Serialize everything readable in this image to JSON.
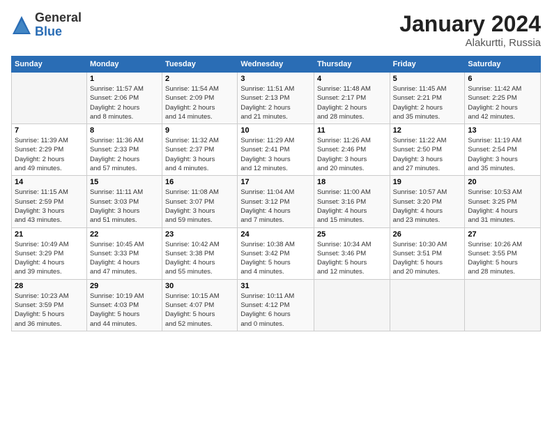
{
  "logo": {
    "general": "General",
    "blue": "Blue"
  },
  "title": "January 2024",
  "location": "Alakurtti, Russia",
  "days_header": [
    "Sunday",
    "Monday",
    "Tuesday",
    "Wednesday",
    "Thursday",
    "Friday",
    "Saturday"
  ],
  "weeks": [
    [
      {
        "num": "",
        "info": ""
      },
      {
        "num": "1",
        "info": "Sunrise: 11:57 AM\nSunset: 2:06 PM\nDaylight: 2 hours\nand 8 minutes."
      },
      {
        "num": "2",
        "info": "Sunrise: 11:54 AM\nSunset: 2:09 PM\nDaylight: 2 hours\nand 14 minutes."
      },
      {
        "num": "3",
        "info": "Sunrise: 11:51 AM\nSunset: 2:13 PM\nDaylight: 2 hours\nand 21 minutes."
      },
      {
        "num": "4",
        "info": "Sunrise: 11:48 AM\nSunset: 2:17 PM\nDaylight: 2 hours\nand 28 minutes."
      },
      {
        "num": "5",
        "info": "Sunrise: 11:45 AM\nSunset: 2:21 PM\nDaylight: 2 hours\nand 35 minutes."
      },
      {
        "num": "6",
        "info": "Sunrise: 11:42 AM\nSunset: 2:25 PM\nDaylight: 2 hours\nand 42 minutes."
      }
    ],
    [
      {
        "num": "7",
        "info": "Sunrise: 11:39 AM\nSunset: 2:29 PM\nDaylight: 2 hours\nand 49 minutes."
      },
      {
        "num": "8",
        "info": "Sunrise: 11:36 AM\nSunset: 2:33 PM\nDaylight: 2 hours\nand 57 minutes."
      },
      {
        "num": "9",
        "info": "Sunrise: 11:32 AM\nSunset: 2:37 PM\nDaylight: 3 hours\nand 4 minutes."
      },
      {
        "num": "10",
        "info": "Sunrise: 11:29 AM\nSunset: 2:41 PM\nDaylight: 3 hours\nand 12 minutes."
      },
      {
        "num": "11",
        "info": "Sunrise: 11:26 AM\nSunset: 2:46 PM\nDaylight: 3 hours\nand 20 minutes."
      },
      {
        "num": "12",
        "info": "Sunrise: 11:22 AM\nSunset: 2:50 PM\nDaylight: 3 hours\nand 27 minutes."
      },
      {
        "num": "13",
        "info": "Sunrise: 11:19 AM\nSunset: 2:54 PM\nDaylight: 3 hours\nand 35 minutes."
      }
    ],
    [
      {
        "num": "14",
        "info": "Sunrise: 11:15 AM\nSunset: 2:59 PM\nDaylight: 3 hours\nand 43 minutes."
      },
      {
        "num": "15",
        "info": "Sunrise: 11:11 AM\nSunset: 3:03 PM\nDaylight: 3 hours\nand 51 minutes."
      },
      {
        "num": "16",
        "info": "Sunrise: 11:08 AM\nSunset: 3:07 PM\nDaylight: 3 hours\nand 59 minutes."
      },
      {
        "num": "17",
        "info": "Sunrise: 11:04 AM\nSunset: 3:12 PM\nDaylight: 4 hours\nand 7 minutes."
      },
      {
        "num": "18",
        "info": "Sunrise: 11:00 AM\nSunset: 3:16 PM\nDaylight: 4 hours\nand 15 minutes."
      },
      {
        "num": "19",
        "info": "Sunrise: 10:57 AM\nSunset: 3:20 PM\nDaylight: 4 hours\nand 23 minutes."
      },
      {
        "num": "20",
        "info": "Sunrise: 10:53 AM\nSunset: 3:25 PM\nDaylight: 4 hours\nand 31 minutes."
      }
    ],
    [
      {
        "num": "21",
        "info": "Sunrise: 10:49 AM\nSunset: 3:29 PM\nDaylight: 4 hours\nand 39 minutes."
      },
      {
        "num": "22",
        "info": "Sunrise: 10:45 AM\nSunset: 3:33 PM\nDaylight: 4 hours\nand 47 minutes."
      },
      {
        "num": "23",
        "info": "Sunrise: 10:42 AM\nSunset: 3:38 PM\nDaylight: 4 hours\nand 55 minutes."
      },
      {
        "num": "24",
        "info": "Sunrise: 10:38 AM\nSunset: 3:42 PM\nDaylight: 5 hours\nand 4 minutes."
      },
      {
        "num": "25",
        "info": "Sunrise: 10:34 AM\nSunset: 3:46 PM\nDaylight: 5 hours\nand 12 minutes."
      },
      {
        "num": "26",
        "info": "Sunrise: 10:30 AM\nSunset: 3:51 PM\nDaylight: 5 hours\nand 20 minutes."
      },
      {
        "num": "27",
        "info": "Sunrise: 10:26 AM\nSunset: 3:55 PM\nDaylight: 5 hours\nand 28 minutes."
      }
    ],
    [
      {
        "num": "28",
        "info": "Sunrise: 10:23 AM\nSunset: 3:59 PM\nDaylight: 5 hours\nand 36 minutes."
      },
      {
        "num": "29",
        "info": "Sunrise: 10:19 AM\nSunset: 4:03 PM\nDaylight: 5 hours\nand 44 minutes."
      },
      {
        "num": "30",
        "info": "Sunrise: 10:15 AM\nSunset: 4:07 PM\nDaylight: 5 hours\nand 52 minutes."
      },
      {
        "num": "31",
        "info": "Sunrise: 10:11 AM\nSunset: 4:12 PM\nDaylight: 6 hours\nand 0 minutes."
      },
      {
        "num": "",
        "info": ""
      },
      {
        "num": "",
        "info": ""
      },
      {
        "num": "",
        "info": ""
      }
    ]
  ]
}
